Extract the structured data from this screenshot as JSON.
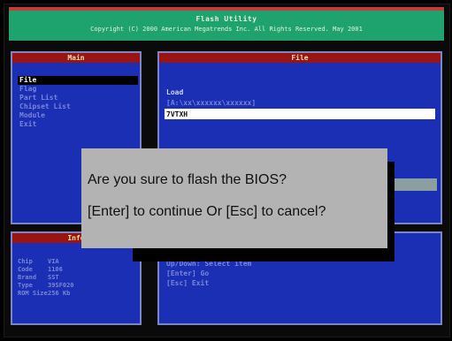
{
  "header": {
    "title": "Flash Utility",
    "copyright": "Copyright (C) 2000 American Megatrends Inc. All Rights Reserved. May 2001"
  },
  "main_panel": {
    "title": "Main",
    "items": [
      {
        "label": "File",
        "selected": true
      },
      {
        "label": "Flag",
        "selected": false
      },
      {
        "label": "Part List",
        "selected": false
      },
      {
        "label": "Chipset List",
        "selected": false
      },
      {
        "label": "Module",
        "selected": false
      },
      {
        "label": "Exit",
        "selected": false
      }
    ]
  },
  "file_panel": {
    "title": "File",
    "load_label": "Load",
    "load_path": "[A:\\xx\\xxxxxx\\xxxxxx]",
    "filename_value": "7VTXH"
  },
  "info_panel": {
    "title": "Info",
    "rows": [
      {
        "key": "Chip",
        "value": "VIA"
      },
      {
        "key": "Code",
        "value": "1106"
      },
      {
        "key": "Brand",
        "value": "SST"
      },
      {
        "key": "Type",
        "value": "39SF020"
      },
      {
        "key": "ROM Size",
        "value": "256 Kb"
      }
    ]
  },
  "help_panel": {
    "rows": [
      "Up/Down: Select item",
      "[Enter] Go",
      "[Esc] Exit"
    ]
  },
  "dialog": {
    "message_line1": "Are you sure to flash the BIOS?",
    "message_line2": "[Enter] to continue Or [Esc] to cancel?"
  },
  "colors": {
    "panel_bg": "#1a2fb4",
    "panel_title_bg": "#9a1414",
    "header_bg": "#1ea36f",
    "dialog_bg": "#b3b3b3"
  }
}
